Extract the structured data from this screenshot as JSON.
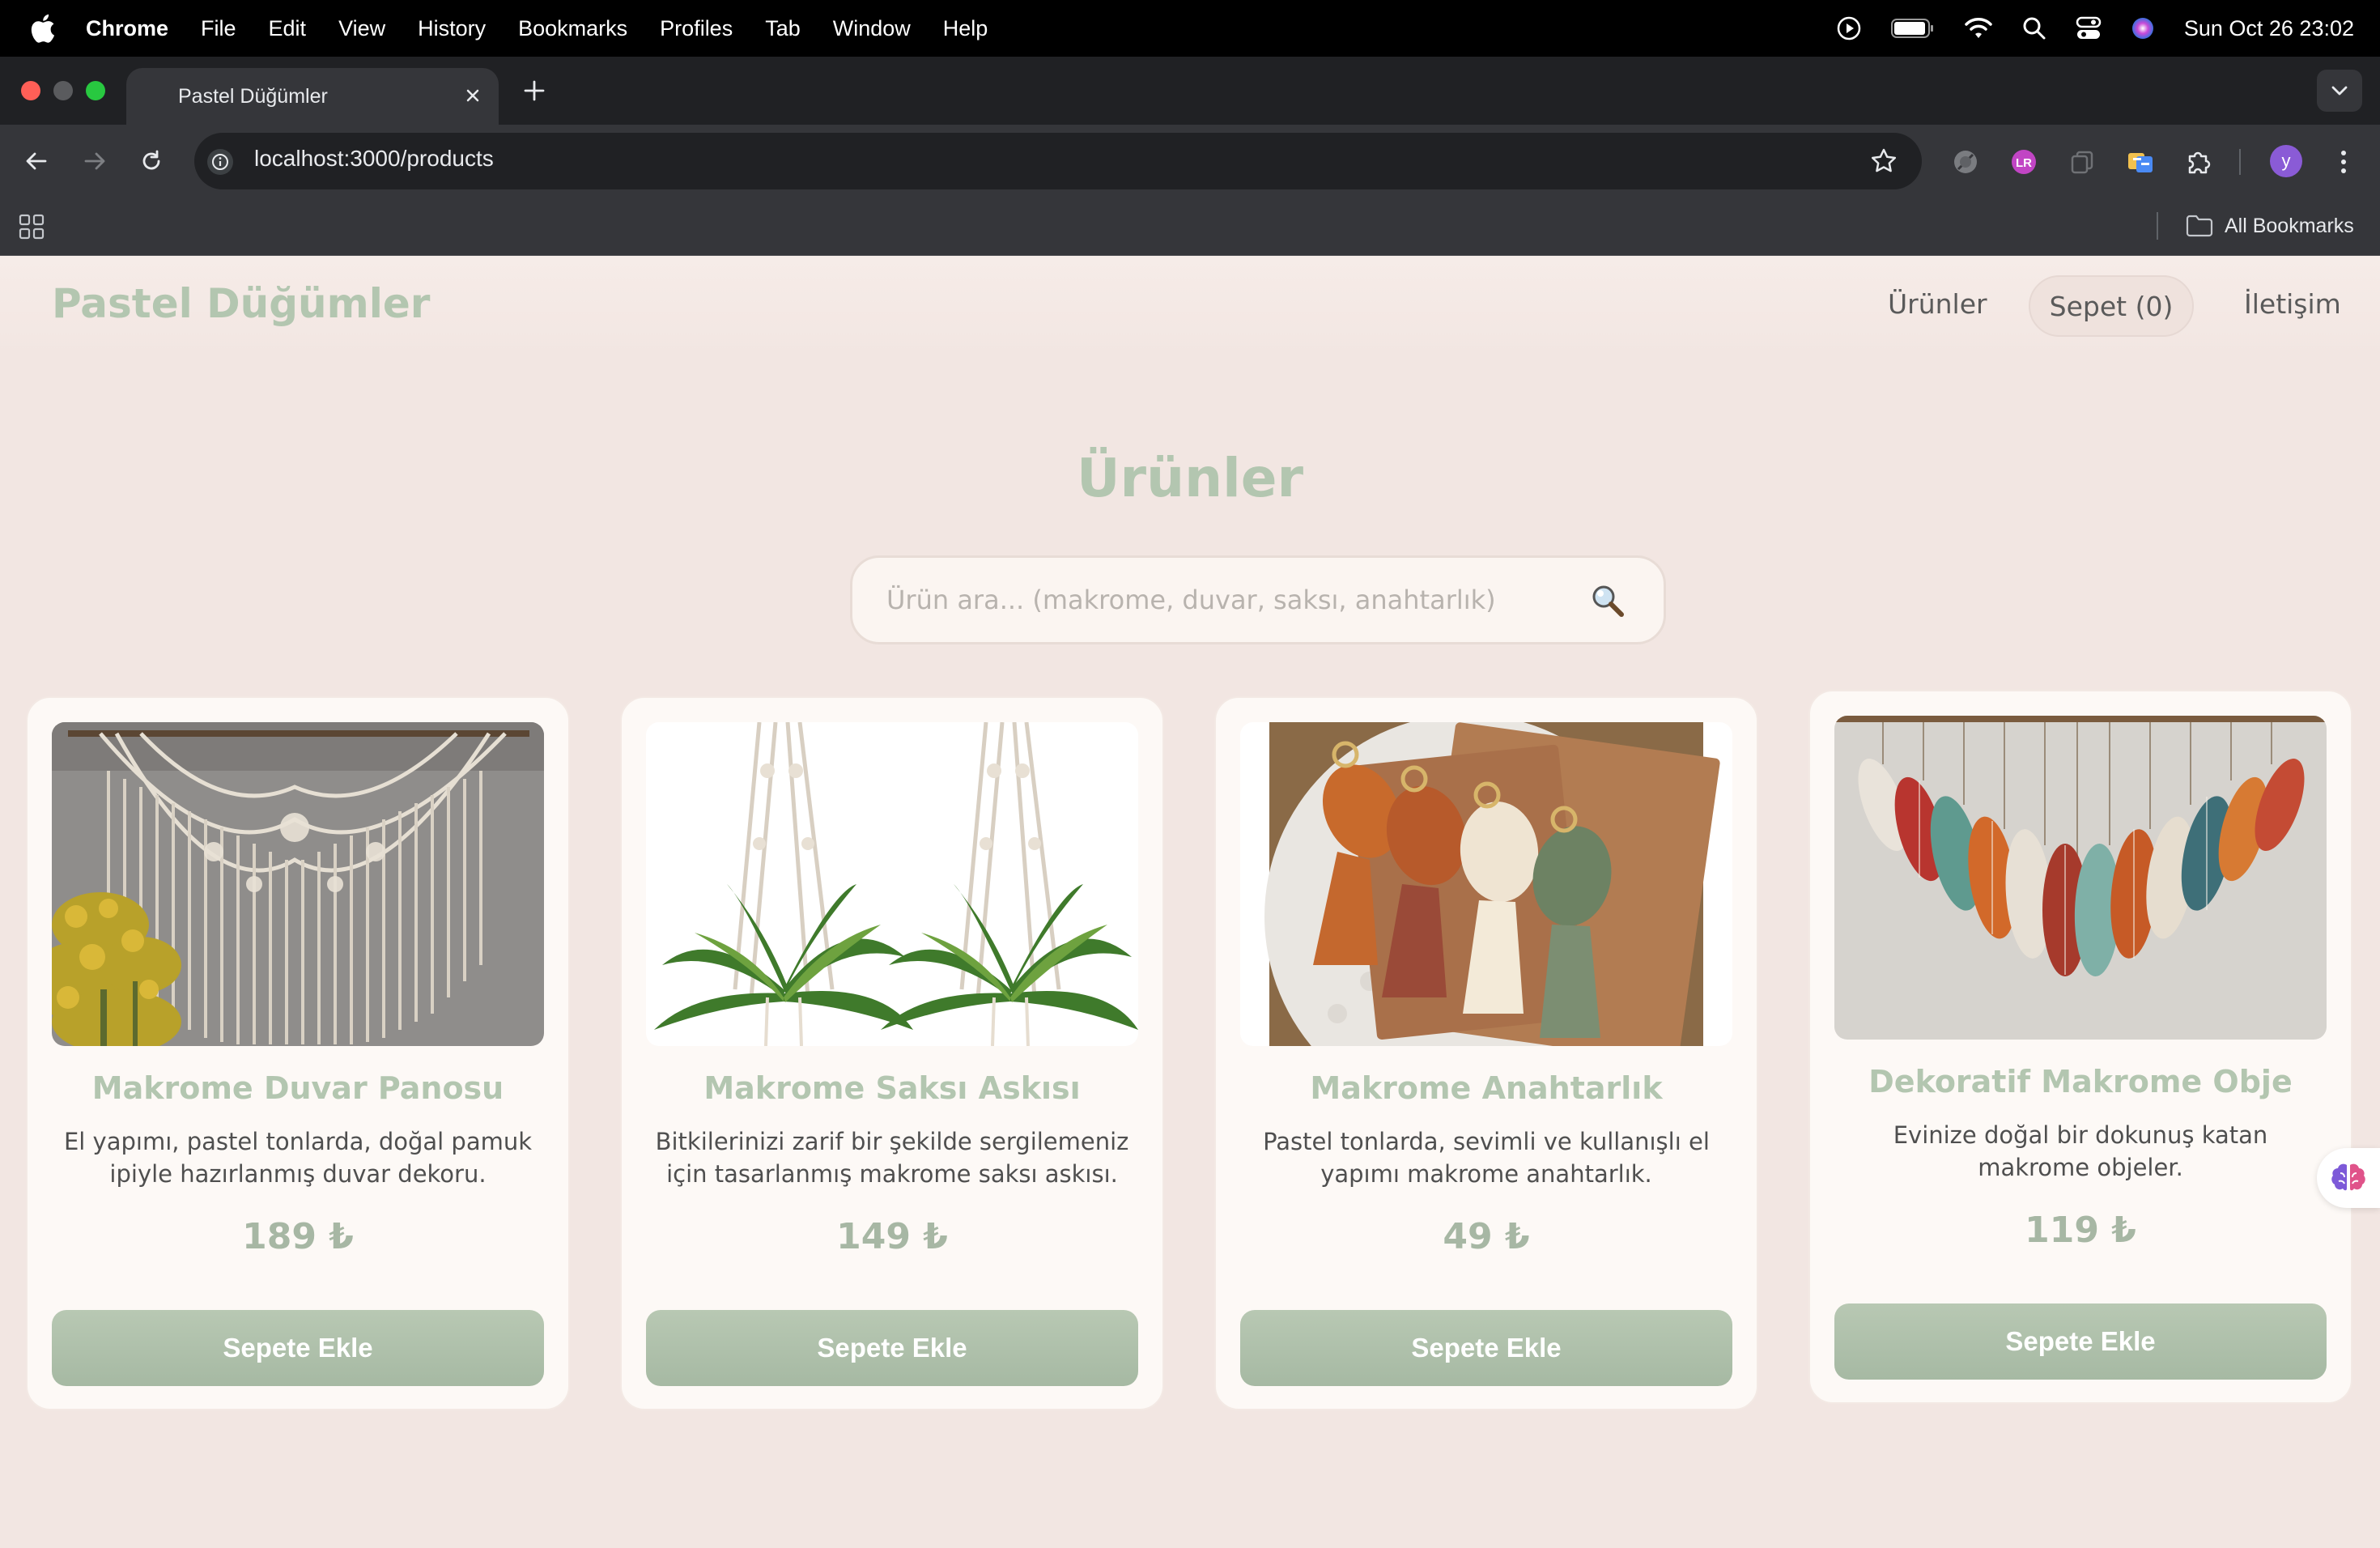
{
  "menubar": {
    "app": "Chrome",
    "items": [
      "File",
      "Edit",
      "View",
      "History",
      "Bookmarks",
      "Profiles",
      "Tab",
      "Window",
      "Help"
    ],
    "clock": "Sun Oct 26  23:02"
  },
  "browser": {
    "tab_title": "Pastel Düğümler",
    "url": "localhost:3000/products",
    "profile_initial": "y",
    "all_bookmarks": "All Bookmarks",
    "ext_badge": "LR"
  },
  "site": {
    "brand": "Pastel Düğümler",
    "nav": {
      "products": "Ürünler",
      "cart": "Sepet (0)",
      "contact": "İletişim"
    },
    "page_title": "Ürünler",
    "search_placeholder": "Ürün ara... (makrome, duvar, saksı, anahtarlık)"
  },
  "products": [
    {
      "name": "Makrome Duvar Panosu",
      "description": "El yapımı, pastel tonlarda, doğal pamuk ipiyle hazırlanmış duvar dekoru.",
      "price": "189 ₺",
      "button": "Sepete Ekle"
    },
    {
      "name": "Makrome Saksı Askısı",
      "description": "Bitkilerinizi zarif bir şekilde sergilemeniz için tasarlanmış makrome saksı askısı.",
      "price": "149 ₺",
      "button": "Sepete Ekle"
    },
    {
      "name": "Makrome Anahtarlık",
      "description": "Pastel tonlarda, sevimli ve kullanışlı el yapımı makrome anahtarlık.",
      "price": "49 ₺",
      "button": "Sepete Ekle"
    },
    {
      "name": "Dekoratif Makrome Obje",
      "description": "Evinize doğal bir dokunuş katan makrome objeler.",
      "price": "119 ₺",
      "button": "Sepete Ekle"
    }
  ],
  "colors": {
    "accent": "#b3c6b0",
    "button": "#a6b9a3",
    "page_bg": "#f2e6e2",
    "card_bg": "#fdf9f6"
  }
}
